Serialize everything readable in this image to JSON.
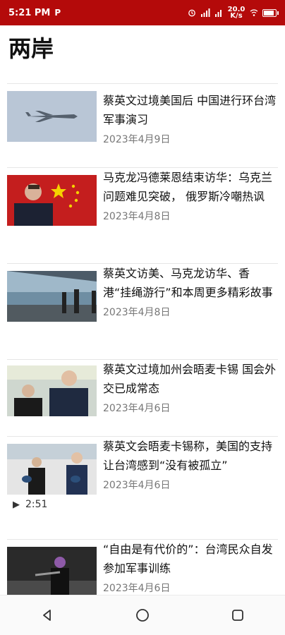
{
  "status": {
    "time": "5:21 PM",
    "p_icon": "P",
    "network_speed": "20.0 K/s",
    "icons": [
      "alarm-icon",
      "signal-icon",
      "wifi-icon",
      "battery-icon"
    ]
  },
  "page": {
    "title": "两岸"
  },
  "articles": [
    {
      "headline": "蔡英文过境美国后 中国进行环台湾军事演习",
      "date": "2023年4月9日"
    },
    {
      "headline": "马克龙冯德莱恩结束访华：乌克兰问题难见突破， 俄罗斯冷嘲热讽",
      "date": "2023年4月8日"
    },
    {
      "headline": "蔡英文访美、马克龙访华、香港“挂绳游行”和本周更多精彩故事",
      "date": "2023年4月8日"
    },
    {
      "headline": "蔡英文过境加州会晤麦卡锡 国会外交已成常态",
      "date": "2023年4月6日"
    },
    {
      "headline": "蔡英文会晤麦卡锡称，美国的支持让台湾感到“没有被孤立”",
      "date": "2023年4月6日",
      "video_duration": "2:51"
    },
    {
      "headline": "“自由是有代价的”：台湾民众自发参加军事训练",
      "date": "2023年4月6日"
    }
  ],
  "nav": {
    "buttons": [
      "back-icon",
      "home-icon",
      "recents-icon"
    ]
  }
}
